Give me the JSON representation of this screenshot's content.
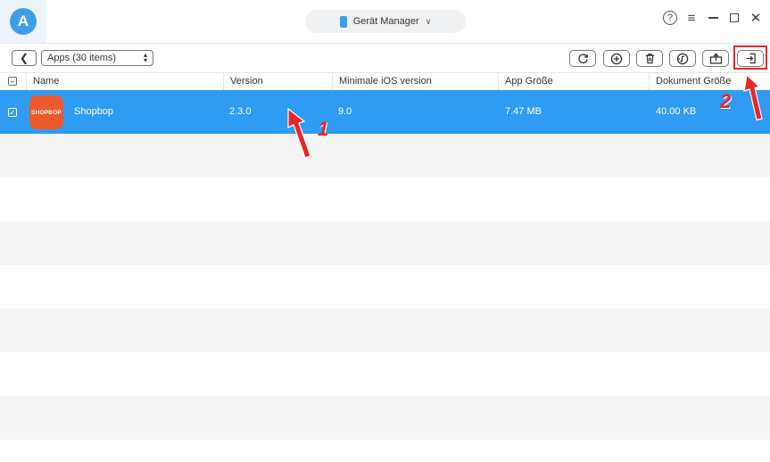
{
  "titlebar": {
    "device_label": "Gerät Manager",
    "help_icon": "?"
  },
  "toolbar": {
    "selector_value": "Apps (30 items)",
    "buttons": [
      "refresh-icon",
      "add-icon",
      "trash-icon",
      "music-transfer-icon",
      "device-upload-icon",
      "export-icon"
    ]
  },
  "table": {
    "headers": [
      "Name",
      "Version",
      "Minimale iOS version",
      "App Größe",
      "Dokument Größe"
    ],
    "rows": [
      {
        "icon_text": "SHOPBOP",
        "name": "Shopbop",
        "version": "2.3.0",
        "min_ios": "9.0",
        "app_size": "7.47 MB",
        "doc_size": "40.00 KB",
        "selected": true
      }
    ]
  },
  "annotations": {
    "marker_1": "1",
    "marker_2": "2"
  },
  "colors": {
    "accent": "#2f9bf2",
    "annotation_red": "#e8262a",
    "app_icon": "#ec5a2c"
  }
}
